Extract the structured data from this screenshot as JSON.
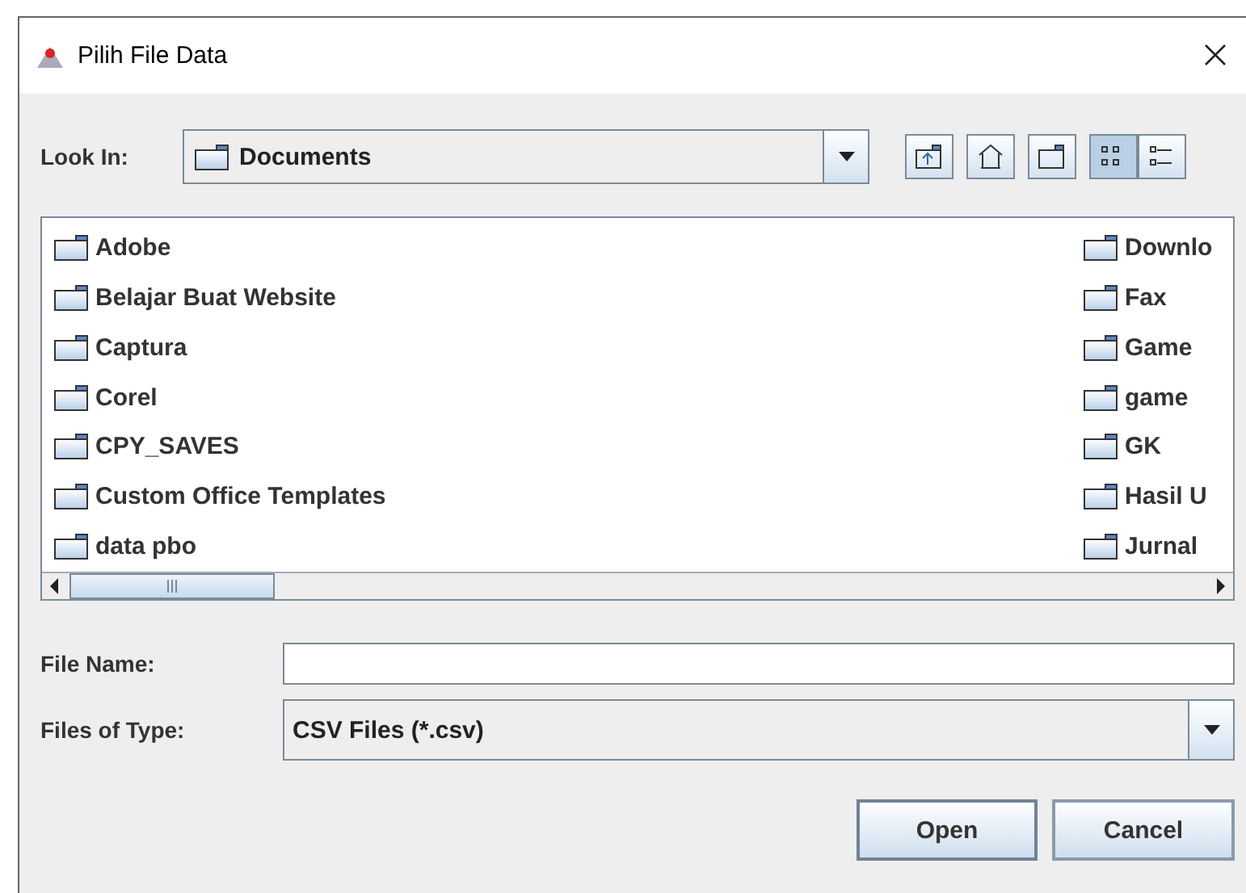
{
  "window": {
    "title": "Pilih File Data"
  },
  "look_in": {
    "label": "Look In:",
    "value": "Documents"
  },
  "toolbar": [
    {
      "kind": "up",
      "selected": false
    },
    {
      "kind": "home",
      "selected": false
    },
    {
      "kind": "new-folder",
      "selected": false
    },
    {
      "kind": "list",
      "selected": true
    },
    {
      "kind": "details",
      "selected": false
    }
  ],
  "file_list": {
    "columns": [
      [
        "Adobe",
        "Belajar Buat Website",
        "Captura",
        "Corel",
        "CPY_SAVES",
        "Custom Office Templates",
        "data pbo"
      ],
      [
        "Downlo",
        "Fax",
        "Game",
        "game",
        "GK",
        "Hasil U",
        "Jurnal"
      ]
    ]
  },
  "file_name": {
    "label": "File Name:"
  },
  "file_type": {
    "label": "Files of Type:",
    "value": "CSV Files (*.csv)"
  },
  "buttons": [
    "Open",
    "Cancel"
  ]
}
